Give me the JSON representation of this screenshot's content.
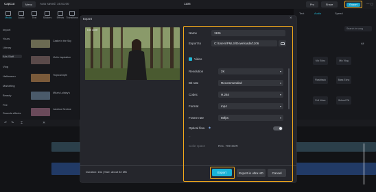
{
  "topbar": {
    "app_name": "CapCut",
    "menu": "Menu",
    "autosave": "Auto saved: 16:51:00",
    "project_title": "1106",
    "pro": "Pro",
    "share": "Share",
    "export": "Export"
  },
  "left": {
    "tabs": [
      "Media",
      "Audio",
      "Text",
      "Stickers",
      "Effects",
      "Transitions"
    ],
    "sidebar": [
      "Import",
      "Yours",
      "Library",
      "Ads Staff",
      "Vlog",
      "Halloween",
      "Marketing",
      "Beauty",
      "Fire",
      "Sounds effects"
    ],
    "media": [
      {
        "title": "Castle in the Sky",
        "sub": "... "
      },
      {
        "title": "Violin inspiration",
        "sub": "... "
      },
      {
        "title": "Tropical style",
        "sub": "... "
      },
      {
        "title": "Mika's Lullaby's",
        "sub": "... "
      },
      {
        "title": "Jukebox Sentme",
        "sub": "... "
      }
    ]
  },
  "right": {
    "tabs": [
      "Text",
      "Audio",
      "Speed"
    ],
    "search": "Search in song",
    "filter": "All",
    "items": [
      "Mic Echo",
      "Mic Vlog",
      "Flashback",
      "Bass Echo",
      "Full Voice",
      "School PA"
    ]
  },
  "modal": {
    "title": "Export",
    "edit_cover": "Edit cover",
    "name_label": "Name",
    "name_value": "1106",
    "export_to_label": "Export to",
    "export_to_value": "C:/Users/FMLS/Downloads/1106",
    "video_section": "Video",
    "resolution_label": "Resolution",
    "resolution_value": "2K",
    "bitrate_label": "Bit rate",
    "bitrate_value": "Recommended",
    "codec_label": "Codec",
    "codec_value": "H.264",
    "format_label": "Format",
    "format_value": "mp4",
    "framerate_label": "Frame rate",
    "framerate_value": "60fps",
    "optical_flow_label": "Optical flow",
    "color_space_label": "Color space",
    "color_space_value": "Rec. 709 SDR",
    "duration": "Duration: 15s | Size: about 52 MB",
    "export_button": "Export",
    "ultra_hd_button": "Export in ultra HD",
    "cancel_button": "Cancel"
  },
  "colors": {
    "highlight": "#f3a91b",
    "accent": "#19b3d6",
    "panel": "#25262c"
  }
}
